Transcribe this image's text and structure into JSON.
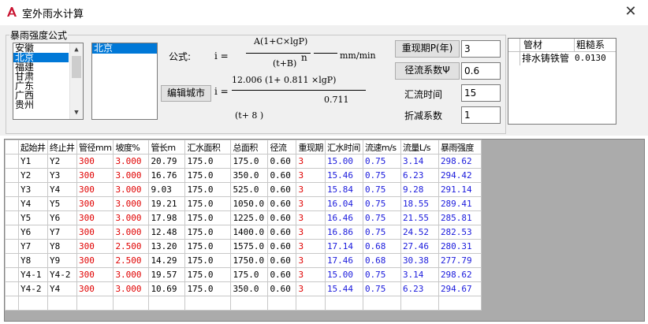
{
  "window": {
    "title": "室外雨水计算",
    "close_glyph": "✕",
    "app_icon": "autocad-a-icon"
  },
  "storm": {
    "group_label": "暴雨强度公式",
    "provinces": [
      "安徽",
      "北京",
      "福建",
      "甘肃",
      "广东",
      "广西",
      "贵州"
    ],
    "selected_province": "北京",
    "cities": [
      "北京"
    ],
    "selected_city": "北京",
    "scroll_up": "▲",
    "scroll_down": "▼"
  },
  "formula": {
    "label": "公式:",
    "i_eq_1": "i =",
    "numerator1": "A(1+C×lgP)",
    "denominator1": "(t+B)",
    "exponent": "n",
    "unit": "mm/min",
    "edit_city_button": "编辑城市",
    "i_eq_2": "i =",
    "numerator2": "12.006  (1+ 0.811  ×lgP)",
    "exp2": "0.711",
    "denominator2": "(t+ 8            )"
  },
  "params": {
    "return_period_button": "重现期P(年)",
    "return_period_value": "3",
    "runoff_button": "径流系数Ψ",
    "runoff_value": "0.6",
    "conc_time_label": "汇流时间",
    "conc_time_value": "15",
    "reduction_label": "折减系数",
    "reduction_value": "1"
  },
  "materials": {
    "headers": [
      "管材",
      "粗糙系"
    ],
    "rows": [
      {
        "name": "排水铸铁管",
        "coef": "0.0130"
      }
    ]
  },
  "grid": {
    "headers": [
      "起始井",
      "终止井",
      "管径mm",
      "坡度%",
      "管长m",
      "汇水面积",
      "总面积",
      "径流",
      "重现期",
      "汇水时间",
      "流速m/s",
      "流量L/s",
      "暴雨强度"
    ],
    "rows": [
      [
        "Y1",
        "Y2",
        "300",
        "3.000",
        "20.79",
        "175.0",
        "175.0",
        "0.60",
        "3",
        "15.00",
        "0.75",
        "3.14",
        "298.62"
      ],
      [
        "Y2",
        "Y3",
        "300",
        "3.000",
        "16.76",
        "175.0",
        "350.0",
        "0.60",
        "3",
        "15.46",
        "0.75",
        "6.23",
        "294.42"
      ],
      [
        "Y3",
        "Y4",
        "300",
        "3.000",
        "9.03",
        "175.0",
        "525.0",
        "0.60",
        "3",
        "15.84",
        "0.75",
        "9.28",
        "291.14"
      ],
      [
        "Y4",
        "Y5",
        "300",
        "3.000",
        "19.21",
        "175.0",
        "1050.0",
        "0.60",
        "3",
        "16.04",
        "0.75",
        "18.55",
        "289.41"
      ],
      [
        "Y5",
        "Y6",
        "300",
        "3.000",
        "17.98",
        "175.0",
        "1225.0",
        "0.60",
        "3",
        "16.46",
        "0.75",
        "21.55",
        "285.81"
      ],
      [
        "Y6",
        "Y7",
        "300",
        "3.000",
        "12.48",
        "175.0",
        "1400.0",
        "0.60",
        "3",
        "16.86",
        "0.75",
        "24.52",
        "282.53"
      ],
      [
        "Y7",
        "Y8",
        "300",
        "2.500",
        "13.20",
        "175.0",
        "1575.0",
        "0.60",
        "3",
        "17.14",
        "0.68",
        "27.46",
        "280.31"
      ],
      [
        "Y8",
        "Y9",
        "300",
        "2.500",
        "14.29",
        "175.0",
        "1750.0",
        "0.60",
        "3",
        "17.46",
        "0.68",
        "30.38",
        "277.79"
      ],
      [
        "Y4-1",
        "Y4-2",
        "300",
        "3.000",
        "19.57",
        "175.0",
        "175.0",
        "0.60",
        "3",
        "15.00",
        "0.75",
        "3.14",
        "298.62"
      ],
      [
        "Y4-2",
        "Y4",
        "300",
        "3.000",
        "10.69",
        "175.0",
        "350.0",
        "0.60",
        "3",
        "15.44",
        "0.75",
        "6.23",
        "294.67"
      ]
    ],
    "column_colors": [
      "",
      "",
      "red",
      "red",
      "",
      "",
      "",
      "",
      "red",
      "blue",
      "blue",
      "blue",
      "blue"
    ],
    "colors": {
      "red": "#e00000",
      "blue": "#1a1adc"
    }
  }
}
